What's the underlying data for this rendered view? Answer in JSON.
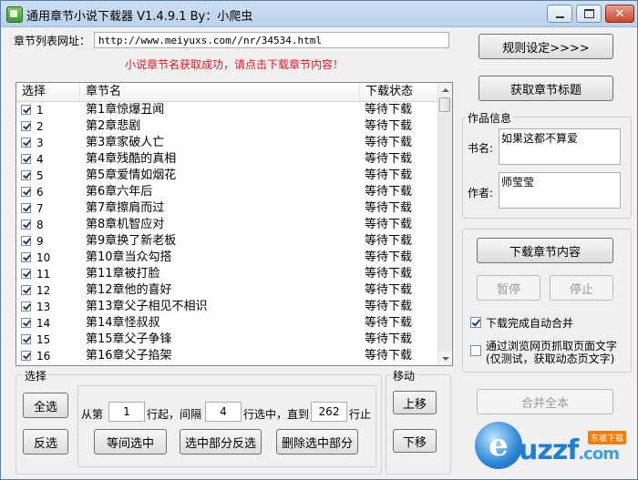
{
  "window": {
    "title": "通用章节小说下载器 V1.4.9.1 By：小爬虫"
  },
  "url_row": {
    "label": "章节列表网址：",
    "value": "http://www.meiyuxs.com//nr/34534.html"
  },
  "status_message": "小说章节名获取成功，请点击下载章节内容！",
  "buttons": {
    "rules": "规则设定>>>>",
    "fetch_titles": "获取章节标题",
    "download": "下载章节内容",
    "pause": "暂停",
    "stop": "停止",
    "merge_all": "合并全本",
    "select_all": "全选",
    "invert": "反选",
    "interval_select": "等间选中",
    "invert_in_selection": "选中部分反选",
    "delete_selected": "删除选中部分",
    "move_up": "上移",
    "move_down": "下移"
  },
  "table": {
    "headers": [
      "选择",
      "章节名",
      "下载状态"
    ],
    "rows": [
      {
        "num": "1",
        "name": "第1章惊爆丑闻",
        "state": "等待下载"
      },
      {
        "num": "2",
        "name": "第2章悲剧",
        "state": "等待下载"
      },
      {
        "num": "3",
        "name": "第3章家破人亡",
        "state": "等待下载"
      },
      {
        "num": "4",
        "name": "第4章残酷的真相",
        "state": "等待下载"
      },
      {
        "num": "5",
        "name": "第5章爱情如烟花",
        "state": "等待下载"
      },
      {
        "num": "6",
        "name": "第6章六年后",
        "state": "等待下载"
      },
      {
        "num": "7",
        "name": "第7章擦肩而过",
        "state": "等待下载"
      },
      {
        "num": "8",
        "name": "第8章机智应对",
        "state": "等待下载"
      },
      {
        "num": "9",
        "name": "第9章换了新老板",
        "state": "等待下载"
      },
      {
        "num": "10",
        "name": "第10章当众勾搭",
        "state": "等待下载"
      },
      {
        "num": "11",
        "name": "第11章被打脸",
        "state": "等待下载"
      },
      {
        "num": "12",
        "name": "第12章他的喜好",
        "state": "等待下载"
      },
      {
        "num": "13",
        "name": "第13章父子相见不相识",
        "state": "等待下载"
      },
      {
        "num": "14",
        "name": "第14章怪叔叔",
        "state": "等待下载"
      },
      {
        "num": "15",
        "name": "第15章父子争锋",
        "state": "等待下载"
      },
      {
        "num": "16",
        "name": "第16章父子掐架",
        "state": "等待下载"
      }
    ]
  },
  "book_info": {
    "group_title": "作品信息",
    "title_label": "书名:",
    "title_value": "如果这都不算爱",
    "author_label": "作者:",
    "author_value": "师莹莹"
  },
  "options": {
    "auto_merge": {
      "label": "下载完成自动合并",
      "checked": true
    },
    "browser_fetch": {
      "label_line1": "通过浏览网页抓取页面文字",
      "label_line2": "(仅测试，获取动态页文字)",
      "checked": false
    }
  },
  "selection": {
    "group_title": "选择",
    "from_label": "从第",
    "from_value": "1",
    "step_label": "行起，间隔",
    "step_value": "4",
    "until_label": "行选中，直到",
    "until_value": "262",
    "row_label": "行止"
  },
  "move": {
    "group_title": "移动"
  },
  "watermark": {
    "brand": "uzzf",
    "domain_suffix": ".com",
    "badge": "东坡下载"
  },
  "colors": {
    "status_message": "#e8161b",
    "title_bar": "#c4d8ee",
    "window_bg": "#f0f0f0"
  }
}
